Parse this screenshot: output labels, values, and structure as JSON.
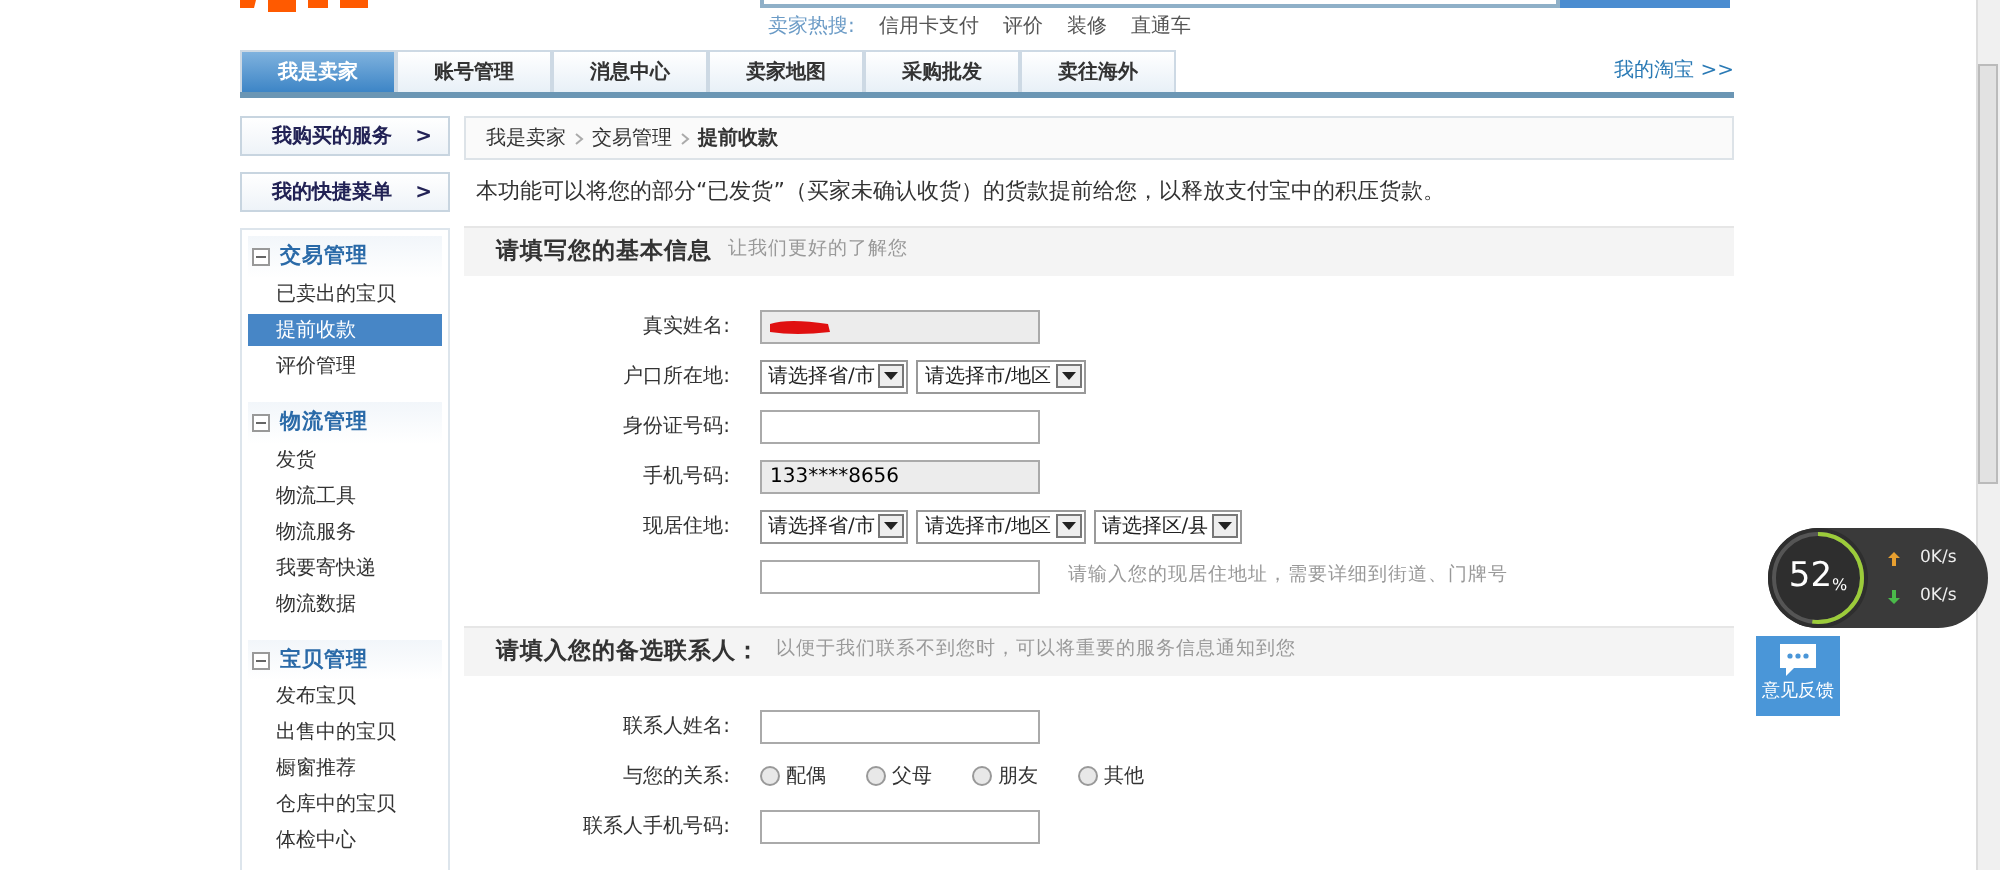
{
  "header": {
    "hot_search_label": "卖家热搜:",
    "hot_search": [
      "信用卡支付",
      "评价",
      "装修",
      "直通车"
    ]
  },
  "tabs": [
    {
      "label": "我是卖家",
      "selected": true
    },
    {
      "label": "账号管理",
      "selected": false
    },
    {
      "label": "消息中心",
      "selected": false
    },
    {
      "label": "卖家地图",
      "selected": false
    },
    {
      "label": "采购批发",
      "selected": false
    },
    {
      "label": "卖往海外",
      "selected": false
    }
  ],
  "my_taobao_link": "我的淘宝 >>",
  "sidebar": {
    "quick_buttons": [
      {
        "label": "我购买的服务",
        "arrow": ">"
      },
      {
        "label": "我的快捷菜单",
        "arrow": ">"
      }
    ],
    "groups": [
      {
        "title": "交易管理",
        "expanded": true,
        "items": [
          {
            "label": "已卖出的宝贝",
            "selected": false
          },
          {
            "label": "提前收款",
            "selected": true
          },
          {
            "label": "评价管理",
            "selected": false
          }
        ]
      },
      {
        "title": "物流管理",
        "expanded": true,
        "items": [
          {
            "label": "发货",
            "selected": false
          },
          {
            "label": "物流工具",
            "selected": false
          },
          {
            "label": "物流服务",
            "selected": false
          },
          {
            "label": "我要寄快递",
            "selected": false
          },
          {
            "label": "物流数据",
            "selected": false
          }
        ]
      },
      {
        "title": "宝贝管理",
        "expanded": true,
        "items": [
          {
            "label": "发布宝贝",
            "selected": false
          },
          {
            "label": "出售中的宝贝",
            "selected": false
          },
          {
            "label": "橱窗推荐",
            "selected": false
          },
          {
            "label": "仓库中的宝贝",
            "selected": false
          },
          {
            "label": "体检中心",
            "selected": false
          }
        ]
      }
    ]
  },
  "breadcrumb": [
    "我是卖家",
    "交易管理",
    "提前收款"
  ],
  "intro": "本功能可以将您的部分“已发货”（买家未确认收货）的货款提前给您，以释放支付宝中的积压货款。",
  "sections": [
    {
      "title": "请填写您的基本信息",
      "subtitle": "让我们更好的了解您",
      "fields": [
        {
          "kind": "text",
          "label": "真实姓名:",
          "readonly": true,
          "redacted": true
        },
        {
          "kind": "select",
          "label": "户口所在地:",
          "selects": [
            "请选择省/市",
            "请选择市/地区"
          ]
        },
        {
          "kind": "text",
          "label": "身份证号码:",
          "readonly": false
        },
        {
          "kind": "text",
          "label": "手机号码:",
          "readonly": true,
          "value": "133****8656"
        },
        {
          "kind": "select",
          "label": "现居住地:",
          "selects": [
            "请选择省/市",
            "请选择市/地区",
            "请选择区/县"
          ]
        },
        {
          "kind": "text",
          "readonly": false,
          "hint": "请输入您的现居住地址，需要详细到街道、门牌号"
        }
      ]
    },
    {
      "title": "请填入您的备选联系人：",
      "subtitle": "以便于我们联系不到您时，可以将重要的服务信息通知到您",
      "fields": [
        {
          "kind": "text",
          "label": "联系人姓名:",
          "readonly": false
        },
        {
          "kind": "radio",
          "label": "与您的关系:",
          "options": [
            {
              "label": "配偶",
              "selected": false
            },
            {
              "label": "父母",
              "selected": false
            },
            {
              "label": "朋友",
              "selected": false
            },
            {
              "label": "其他",
              "selected": false
            }
          ]
        },
        {
          "kind": "text",
          "label": "联系人手机号码:",
          "readonly": false
        }
      ]
    }
  ],
  "speed_widget": {
    "percent": "52",
    "unit": "%",
    "level": 0.52,
    "upload": "0K/s",
    "download": "0K/s"
  },
  "feedback": "意见反馈"
}
